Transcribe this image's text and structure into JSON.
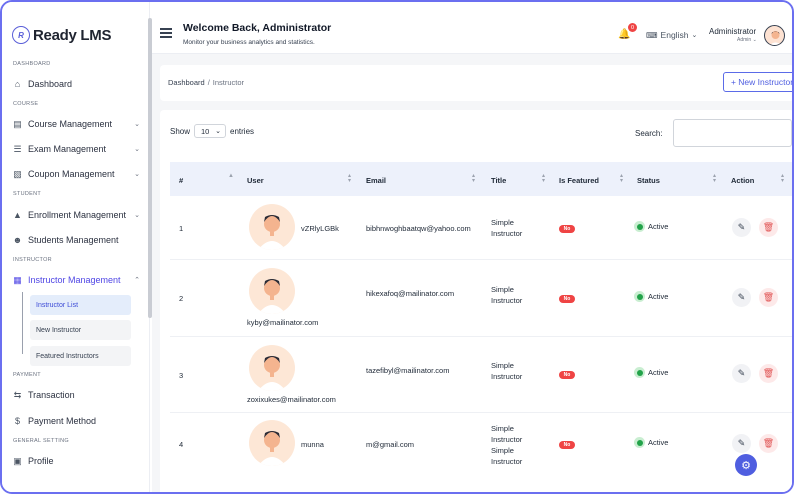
{
  "sidebar": {
    "logo_mark": "R",
    "logo_text": "Ready LMS",
    "sections": [
      "DASHBOARD",
      "COURSE",
      "STUDENT",
      "INSTRUCTOR",
      "PAYMENT",
      "GENERAL SETTING"
    ],
    "items": [
      {
        "label": "Dashboard",
        "icon": "home-icon"
      },
      {
        "label": "Course Management",
        "icon": "book-icon"
      },
      {
        "label": "Exam Management",
        "icon": "exam-icon"
      },
      {
        "label": "Coupon Management",
        "icon": "coupon-icon"
      },
      {
        "label": "Enrollment Management",
        "icon": "enroll-icon"
      },
      {
        "label": "Students Management",
        "icon": "students-icon"
      },
      {
        "label": "Instructor Management",
        "icon": "instructor-icon"
      },
      {
        "label": "Transaction",
        "icon": "transaction-icon"
      },
      {
        "label": "Payment Method",
        "icon": "payment-icon"
      },
      {
        "label": "Profile",
        "icon": "profile-icon"
      }
    ],
    "sub_items": [
      "Instructor List",
      "New Instructor",
      "Featured Instructors"
    ]
  },
  "header": {
    "title": "Welcome Back, Administrator",
    "subtitle": "Monitor your business analytics and statistics.",
    "notification_count": "0",
    "language": "English",
    "user_name": "Administrator",
    "user_role": "Admin"
  },
  "breadcrumb": {
    "root": "Dashboard",
    "separator": "/",
    "current": "Instructor"
  },
  "new_button": "+ New Instructor",
  "table_controls": {
    "show_label": "Show",
    "entries_value": "10",
    "entries_label": "entries",
    "search_label": "Search:"
  },
  "table": {
    "columns": [
      "#",
      "User",
      "Email",
      "Title",
      "Is Featured",
      "Status",
      "Action"
    ],
    "rows": [
      {
        "num": "1",
        "name": "vZRlyLGBk",
        "email": "bibhnwoghbaatqw@yahoo.com",
        "title1": "Simple",
        "title2": "Instructor",
        "title3": "",
        "title4": "",
        "featured": "No",
        "status": "Active"
      },
      {
        "num": "2",
        "name": "kyby@mailinator.com",
        "email": "hikexafoq@mailinator.com",
        "title1": "Simple",
        "title2": "Instructor",
        "title3": "",
        "title4": "",
        "featured": "No",
        "status": "Active"
      },
      {
        "num": "3",
        "name": "zoxixukes@mailinator.com",
        "email": "tazefibyl@mailinator.com",
        "title1": "Simple",
        "title2": "Instructor",
        "title3": "",
        "title4": "",
        "featured": "No",
        "status": "Active"
      },
      {
        "num": "4",
        "name": "munna",
        "email": "m@gmail.com",
        "title1": "Simple",
        "title2": "Instructor",
        "title3": "Simple",
        "title4": "Instructor",
        "featured": "No",
        "status": "Active"
      }
    ]
  },
  "colors": {
    "accent": "#4f5ee0",
    "danger": "#ef4444",
    "success": "#22a34a"
  }
}
